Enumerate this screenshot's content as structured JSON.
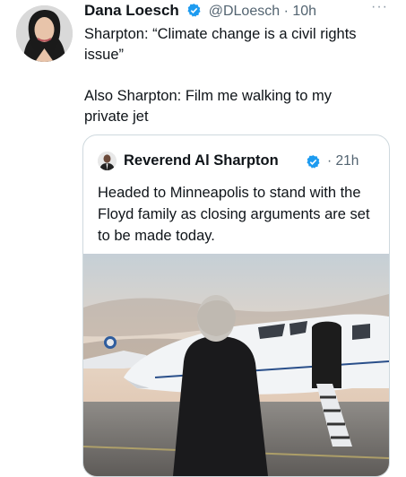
{
  "tweet": {
    "display_name": "Dana Loesch",
    "handle": "@DLoesch",
    "time": "· 10h",
    "more": "···",
    "text_line1": "Sharpton: “Climate change is a civil rights issue”",
    "text_line2": "Also Sharpton: Film me walking to my private jet"
  },
  "quoted": {
    "display_name": "Reverend Al Sharpton",
    "time": "· 21h",
    "text": "Headed to Minneapolis to stand with the Floyd family as closing arguments are set to be made today."
  },
  "colors": {
    "verified": "#1d9bf0",
    "secondary_text": "#536471",
    "border": "#cfd9de"
  },
  "icons": {
    "verified": "verified-badge-icon",
    "more": "more-options-icon"
  }
}
